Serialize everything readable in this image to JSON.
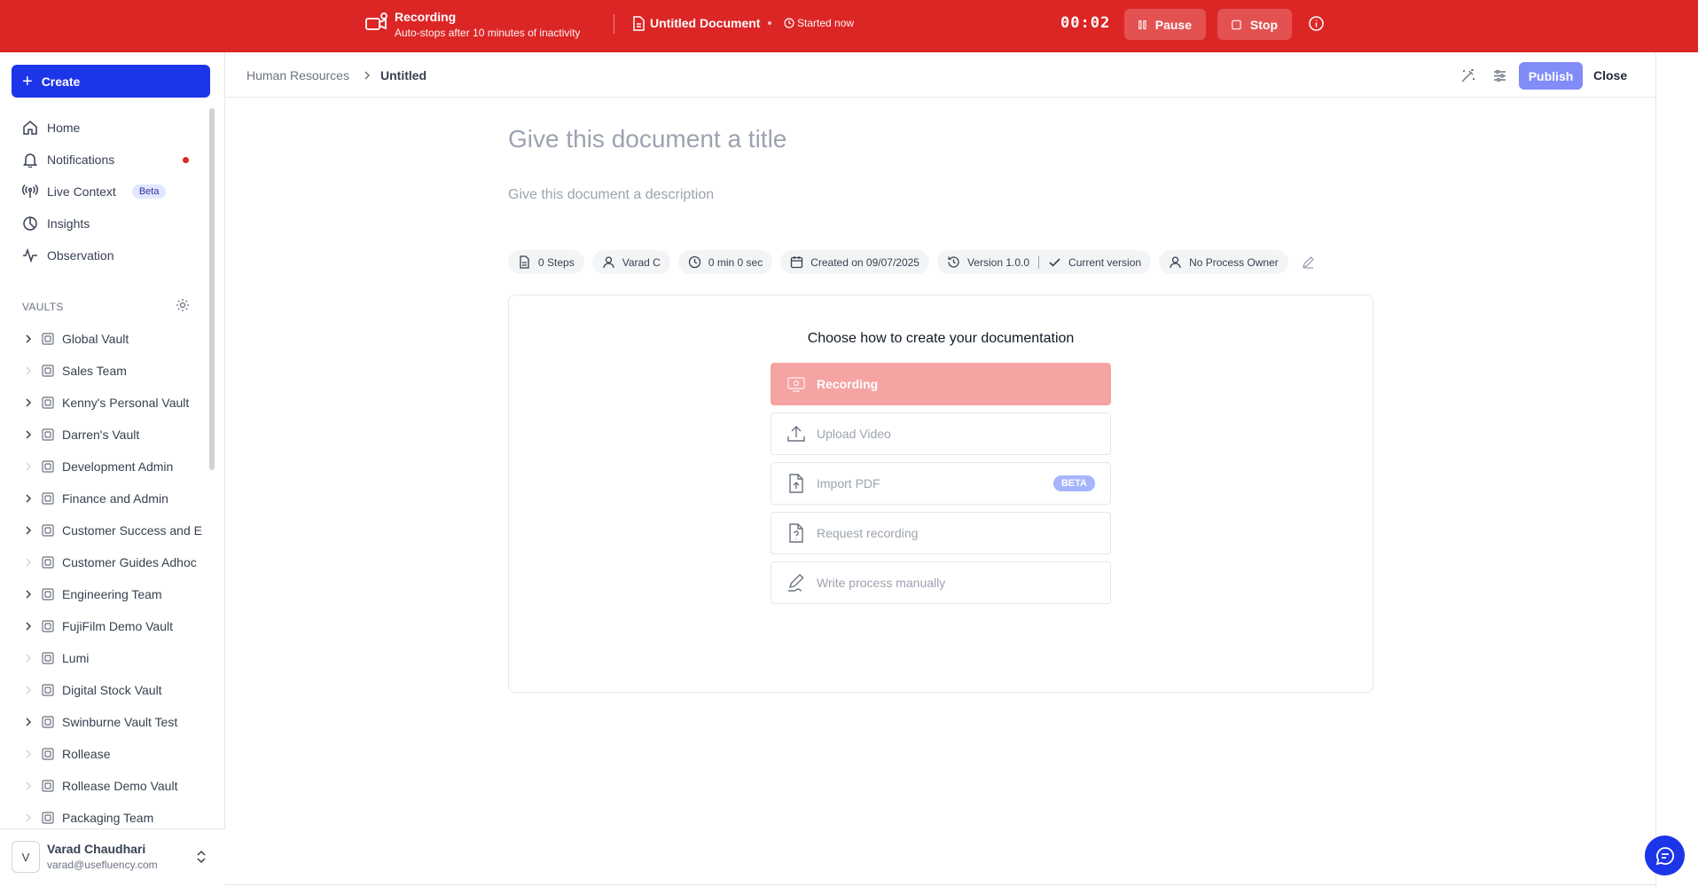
{
  "recording_bar": {
    "title": "Recording",
    "subtitle": "Auto-stops after 10 minutes of inactivity",
    "document_name": "Untitled Document",
    "started": "Started now",
    "timer": "00:02",
    "pause_label": "Pause",
    "stop_label": "Stop"
  },
  "sidebar": {
    "create_label": "Create",
    "nav": [
      {
        "label": "Home",
        "icon": "home-icon"
      },
      {
        "label": "Notifications",
        "icon": "bell-icon"
      },
      {
        "label": "Live Context",
        "icon": "broadcast-icon",
        "badge": "Beta"
      },
      {
        "label": "Insights",
        "icon": "pie-chart-icon"
      },
      {
        "label": "Observation",
        "icon": "activity-icon"
      }
    ],
    "vaults_heading": "VAULTS",
    "vaults": [
      {
        "label": "Global Vault",
        "expandable": true
      },
      {
        "label": "Sales Team",
        "expandable": false
      },
      {
        "label": "Kenny's Personal Vault",
        "expandable": true
      },
      {
        "label": "Darren's Vault",
        "expandable": true
      },
      {
        "label": "Development Admin",
        "expandable": false
      },
      {
        "label": "Finance and Admin",
        "expandable": true
      },
      {
        "label": "Customer Success and E",
        "expandable": true
      },
      {
        "label": "Customer Guides Adhoc",
        "expandable": false
      },
      {
        "label": "Engineering Team",
        "expandable": true
      },
      {
        "label": "FujiFilm Demo Vault",
        "expandable": true
      },
      {
        "label": "Lumi",
        "expandable": false
      },
      {
        "label": "Digital Stock Vault",
        "expandable": false
      },
      {
        "label": "Swinburne Vault Test",
        "expandable": true
      },
      {
        "label": "Rollease",
        "expandable": false
      },
      {
        "label": "Rollease Demo Vault",
        "expandable": false
      },
      {
        "label": "Packaging Team",
        "expandable": false
      }
    ],
    "user": {
      "initial": "V",
      "name": "Varad Chaudhari",
      "email": "varad@usefluency.com"
    }
  },
  "header": {
    "breadcrumb_root": "Human Resources",
    "breadcrumb_current": "Untitled",
    "publish_label": "Publish",
    "close_label": "Close"
  },
  "document": {
    "title_placeholder": "Give this document a title",
    "description_placeholder": "Give this document a description",
    "meta": {
      "steps": "0 Steps",
      "author": "Varad C",
      "duration": "0 min 0 sec",
      "created": "Created on 09/07/2025",
      "version": "Version 1.0.0",
      "current_version": "Current version",
      "owner": "No Process Owner"
    },
    "creation_card": {
      "title": "Choose how to create your documentation",
      "options": [
        {
          "label": "Recording",
          "icon": "screen-record-icon"
        },
        {
          "label": "Upload Video",
          "icon": "upload-icon"
        },
        {
          "label": "Import PDF",
          "icon": "pdf-file-icon",
          "badge": "BETA"
        },
        {
          "label": "Request recording",
          "icon": "question-file-icon"
        },
        {
          "label": "Write process manually",
          "icon": "pen-icon"
        }
      ]
    }
  },
  "colors": {
    "recording_red": "#dc2626",
    "brand_blue": "#1d35e8",
    "publish_indigo": "#818cf8",
    "recording_option_bg": "#f6a3a3"
  }
}
